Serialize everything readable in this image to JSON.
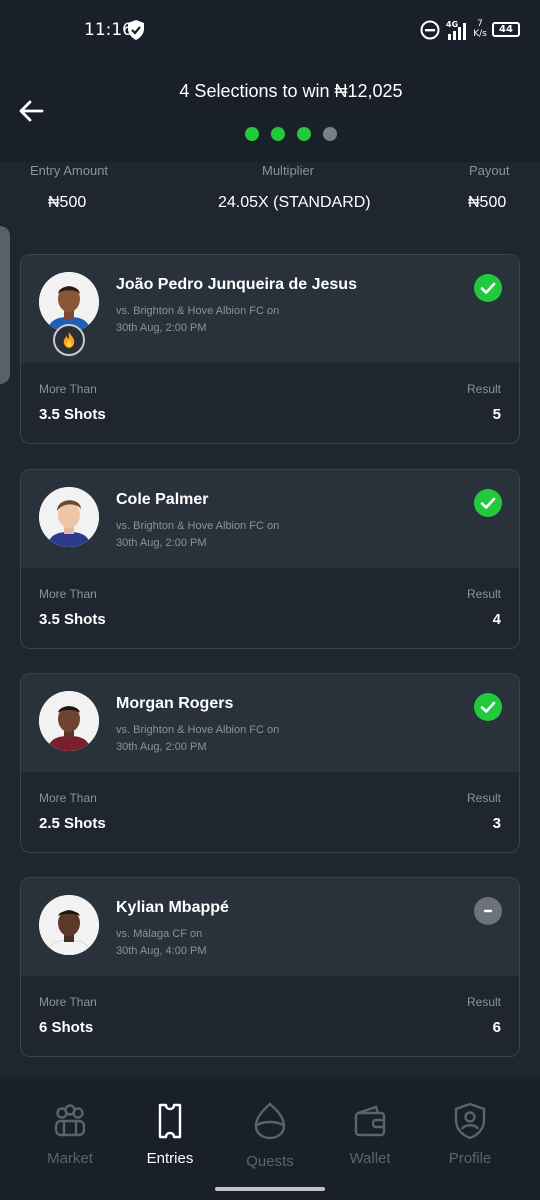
{
  "status_bar": {
    "time": "11:16",
    "speed_top": "7",
    "speed_bottom": "K/s",
    "battery": "44"
  },
  "header": {
    "title": "4 Selections to win ₦12,025",
    "progress": [
      true,
      true,
      true,
      false
    ]
  },
  "summary": {
    "entry_label": "Entry Amount",
    "entry_value": "₦500",
    "multiplier_label": "Multiplier",
    "multiplier_value": "24.05X (STANDARD)",
    "payout_label": "Payout",
    "payout_value": "₦500"
  },
  "picks": [
    {
      "name": "João Pedro Junqueira de Jesus",
      "opponent": "vs. Brighton & Hove Albion FC on",
      "date": "30th Aug, 2:00 PM",
      "line_label": "More Than",
      "line": "3.5 Shots",
      "result_label": "Result",
      "result": "5",
      "status": "won",
      "hot": true
    },
    {
      "name": "Cole Palmer",
      "opponent": "vs. Brighton & Hove Albion FC on",
      "date": "30th Aug, 2:00 PM",
      "line_label": "More Than",
      "line": "3.5 Shots",
      "result_label": "Result",
      "result": "4",
      "status": "won",
      "hot": false
    },
    {
      "name": "Morgan Rogers",
      "opponent": "vs. Brighton & Hove Albion FC on",
      "date": "30th Aug, 2:00 PM",
      "line_label": "More Than",
      "line": "2.5 Shots",
      "result_label": "Result",
      "result": "3",
      "status": "won",
      "hot": false
    },
    {
      "name": "Kylian Mbappé",
      "opponent": "vs. Málaga CF on",
      "date": "30th Aug, 4:00 PM",
      "line_label": "More Than",
      "line": "6 Shots",
      "result_label": "Result",
      "result": "6",
      "status": "push",
      "hot": false
    }
  ],
  "nav": [
    {
      "label": "Market",
      "icon": "market-icon",
      "active": false
    },
    {
      "label": "Entries",
      "icon": "ticket-icon",
      "active": true
    },
    {
      "label": "Quests",
      "icon": "quests-icon",
      "active": false
    },
    {
      "label": "Wallet",
      "icon": "wallet-icon",
      "active": false
    },
    {
      "label": "Profile",
      "icon": "profile-shield-icon",
      "active": false
    }
  ],
  "colors": {
    "accent_green": "#22c93c",
    "background": "#1f2630",
    "card_top": "#29313b",
    "muted_text": "#8b929b",
    "inactive_nav": "#5b636d"
  }
}
